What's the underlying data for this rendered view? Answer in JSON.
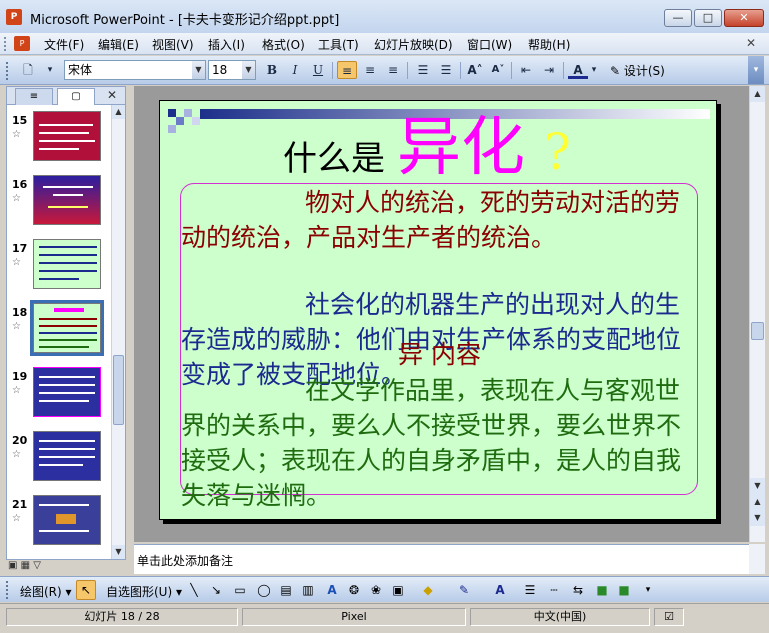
{
  "window": {
    "title": "Microsoft PowerPoint - [卡夫卡变形记介绍ppt.ppt]",
    "app_icon_label": "P",
    "minimize": "—",
    "maximize": "□",
    "close": "✕"
  },
  "menu": {
    "items": [
      "文件(F)",
      "编辑(E)",
      "视图(V)",
      "插入(I)",
      "格式(O)",
      "工具(T)",
      "幻灯片放映(D)",
      "窗口(W)",
      "帮助(H)"
    ],
    "close_glyph": "✕"
  },
  "toolbar": {
    "font_name": "宋体",
    "font_size": "18",
    "bold": "B",
    "italic": "I",
    "underline": "U",
    "design_label": "设计(S)"
  },
  "pane": {
    "tab_outline": "≡",
    "tab_slides": "▢",
    "close": "✕",
    "thumbnails": [
      {
        "num": "15",
        "bg": "#b0103a",
        "selected": false
      },
      {
        "num": "16",
        "bg": "#8a1a8a",
        "selected": false
      },
      {
        "num": "17",
        "bg": "#2b2fa0",
        "selected": false
      },
      {
        "num": "18",
        "bg": "#ccffcc",
        "selected": true
      },
      {
        "num": "19",
        "bg": "#2b2fa0",
        "selected": false
      },
      {
        "num": "20",
        "bg": "#2b2fa0",
        "selected": false
      },
      {
        "num": "21",
        "bg": "#3a3f9a",
        "selected": false
      }
    ]
  },
  "slide": {
    "title_prefix": "什么是",
    "title_emph": "异化",
    "title_q": "?",
    "para1": "物对人的统治，死的劳动对活的劳动的统治，产品对生产者的统治。",
    "para2": "社会化的机器生产的出现对人的生存造成的威胁：他们由对生产体系的支配地位变成了被支配地位。",
    "overlap": "异 内容",
    "para3": "在文学作品里，表现在人与客观世界的关系中，要么人不接受世界，要么世界不接受人；表现在人的自身矛盾中，是人的自我失落与迷惘。"
  },
  "notes": {
    "placeholder": "单击此处添加备注"
  },
  "drawing": {
    "draw_label": "绘图(R)",
    "autoshape_label": "自选图形(U)"
  },
  "status": {
    "slide_pos": "幻灯片 18 / 28",
    "template": "Pixel",
    "language": "中文(中国)"
  },
  "colors": {
    "slide_bg": "#ccffcc",
    "title_emph": "#ff00ff",
    "para1": "#8b0000",
    "para2": "#1c2a90",
    "para3": "#1f6b0f"
  }
}
